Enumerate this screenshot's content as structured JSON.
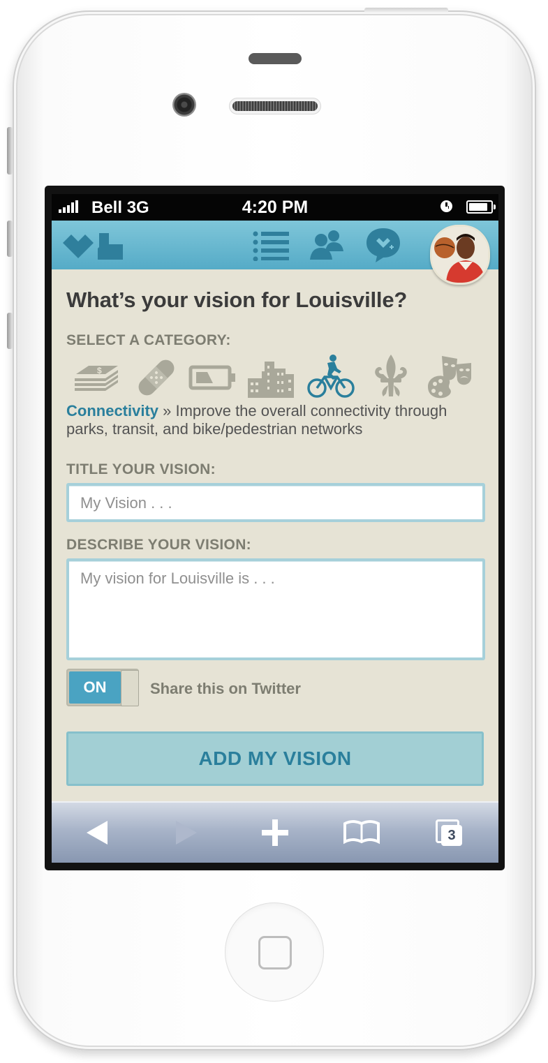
{
  "status_bar": {
    "carrier": "Bell",
    "network": "3G",
    "time": "4:20 PM"
  },
  "nav": {
    "logo_icon": "heart-blocks-logo",
    "icons": [
      "list-icon",
      "people-icon",
      "chat-heart-icon"
    ],
    "avatar": "profile-avatar"
  },
  "page": {
    "heading": "What’s your vision for Louisville?",
    "category_label": "SELECT A CATEGORY:",
    "categories": [
      {
        "icon": "money-stack-icon",
        "selected": false
      },
      {
        "icon": "bandage-icon",
        "selected": false
      },
      {
        "icon": "battery-icon",
        "selected": false
      },
      {
        "icon": "buildings-icon",
        "selected": false
      },
      {
        "icon": "bicycle-icon",
        "selected": true
      },
      {
        "icon": "fleur-de-lis-icon",
        "selected": false
      },
      {
        "icon": "arts-palette-masks-icon",
        "selected": false
      }
    ],
    "selected_category": {
      "name": "Connectivity",
      "description": " » Improve the overall connectivity through parks, transit, and bike/pedestrian networks"
    },
    "title_label": "TITLE YOUR VISION:",
    "title_placeholder": "My Vision . . .",
    "describe_label": "DESCRIBE YOUR VISION:",
    "describe_placeholder": "My vision for Louisville is . . .",
    "toggle_state": "ON",
    "toggle_label": "Share this on Twitter",
    "submit_label": "ADD MY VISION"
  },
  "browser_toolbar": {
    "buttons": [
      "back-icon",
      "forward-icon",
      "add-icon",
      "bookmarks-icon",
      "tabs-icon"
    ],
    "tab_count": "3"
  },
  "colors": {
    "nav_bar": "#62b4cd",
    "accent": "#2a7f9c",
    "background": "#e6e3d5",
    "toggle_on": "#4aa3c2",
    "submit": "#a2cfd4"
  }
}
